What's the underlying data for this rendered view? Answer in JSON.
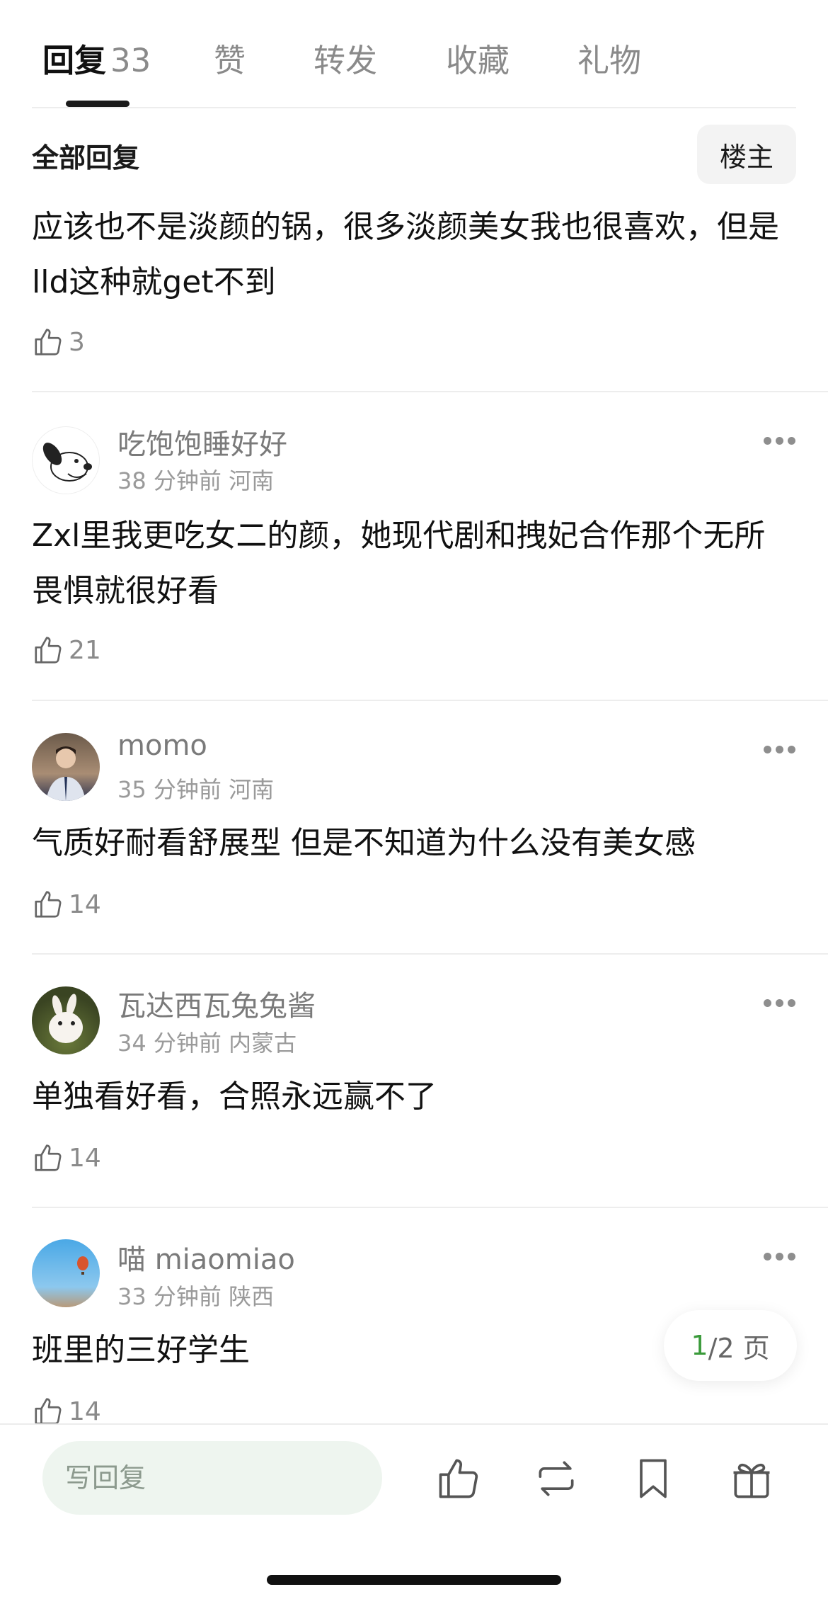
{
  "tabs": [
    {
      "label": "回复",
      "count": "33",
      "active": true
    },
    {
      "label": "赞"
    },
    {
      "label": "转发"
    },
    {
      "label": "收藏"
    },
    {
      "label": "礼物"
    }
  ],
  "section": {
    "title": "全部回复",
    "op_button": "楼主"
  },
  "top_comment": {
    "text": "应该也不是淡颜的锅，很多淡颜美女我也很喜欢，但是lld这种就get不到",
    "likes": "3"
  },
  "comments": [
    {
      "username": "吃饱饱睡好好",
      "time": "38 分钟前",
      "location": "河南",
      "text": "Zxl里我更吃女二的颜，她现代剧和拽妃合作那个无所畏惧就很好看",
      "likes": "21",
      "avatar": "snoopy-avatar"
    },
    {
      "username": "momo",
      "time": "35 分钟前",
      "location": "河南",
      "text": "气质好耐看舒展型 但是不知道为什么没有美女感",
      "likes": "14",
      "avatar": "person-selfie-avatar"
    },
    {
      "username": "瓦达西瓦兔兔酱",
      "time": "34 分钟前",
      "location": "内蒙古",
      "text": "单独看好看，合照永远赢不了",
      "likes": "14",
      "avatar": "rabbit-avatar"
    },
    {
      "username": "喵 miaomiao",
      "time": "33 分钟前",
      "location": "陕西",
      "text": "班里的三好学生",
      "likes": "14",
      "avatar": "hot-air-balloon-avatar"
    }
  ],
  "pagination": {
    "current": "1",
    "total": "/2 页"
  },
  "bottom_bar": {
    "reply_placeholder": "写回复",
    "icons": [
      "like-icon",
      "repost-icon",
      "bookmark-icon",
      "gift-icon"
    ]
  },
  "colors": {
    "accent_green": "#3a9a3a",
    "input_bg": "#eef5ef"
  }
}
